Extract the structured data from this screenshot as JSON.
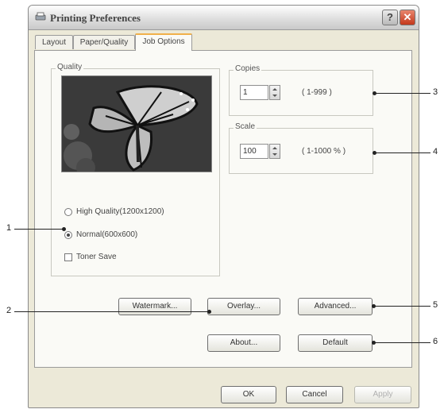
{
  "window": {
    "title": "Printing Preferences",
    "help_label": "?",
    "close_label": "✕"
  },
  "tabs": [
    {
      "label": "Layout"
    },
    {
      "label": "Paper/Quality"
    },
    {
      "label": "Job Options",
      "active": true
    }
  ],
  "quality": {
    "title": "Quality",
    "options": [
      {
        "label": "High Quality(1200x1200)",
        "selected": false
      },
      {
        "label": "Normal(600x600)",
        "selected": true
      }
    ],
    "toner_save": {
      "label": "Toner Save",
      "checked": false
    }
  },
  "copies": {
    "title": "Copies",
    "value": "1",
    "range": "( 1-999 )"
  },
  "scale": {
    "title": "Scale",
    "value": "100",
    "range": "( 1-1000 % )"
  },
  "buttons": {
    "watermark": "Watermark...",
    "overlay": "Overlay...",
    "advanced": "Advanced...",
    "about": "About...",
    "default": "Default",
    "ok": "OK",
    "cancel": "Cancel",
    "apply": "Apply"
  },
  "callouts": [
    "1",
    "2",
    "3",
    "4",
    "5",
    "6"
  ]
}
